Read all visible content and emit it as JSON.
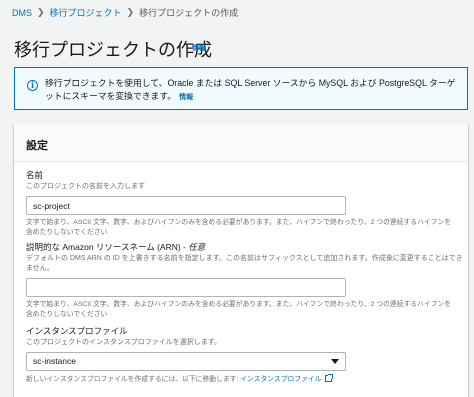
{
  "breadcrumb": {
    "root": "DMS",
    "parent": "移行プロジェクト",
    "current": "移行プロジェクトの作成"
  },
  "page": {
    "title": "移行プロジェクトの作成",
    "info_link": "情報"
  },
  "alert": {
    "text": "移行プロジェクトを使用して、Oracle または SQL Server ソースから MySQL および PostgreSQL ターゲットにスキーマを変換できます。",
    "info_link": "情報"
  },
  "settings": {
    "heading": "設定",
    "name": {
      "label": "名前",
      "description": "このプロジェクトの名前を入力します",
      "value": "sc-project",
      "constraint": "文字で始まり、ASCII 文字、数字、およびハイフンのみを含める必要があります。また、ハイフンで終わったり、2 つの連続するハイフンを含めたりしないでください"
    },
    "arn": {
      "label": "説明的な Amazon リソースネーム (ARN) - ",
      "optional": "任意",
      "description": "デフォルトの DMS ARN の ID を上書きする名前を指定します。この名前はサフィックスとして追加されます。作成後に変更することはできません。",
      "value": "",
      "constraint": "文字で始まり、ASCII 文字、数字、およびハイフンのみを含める必要があります。また、ハイフンで終わったり、2 つの連続するハイフンを含めたりしないでください"
    },
    "instance_profile": {
      "label": "インスタンスプロファイル",
      "description": "このプロジェクトのインスタンスプロファイルを選択します。",
      "selected": "sc-instance",
      "note": "新しいインスタンスプロファイルを作成するには、以下に移動します: ",
      "note_link": "インスタンスプロファイル"
    }
  },
  "colors": {
    "link": "#0073bb",
    "alert_bg": "#f1faff",
    "page_bg": "#f2f3f3"
  }
}
